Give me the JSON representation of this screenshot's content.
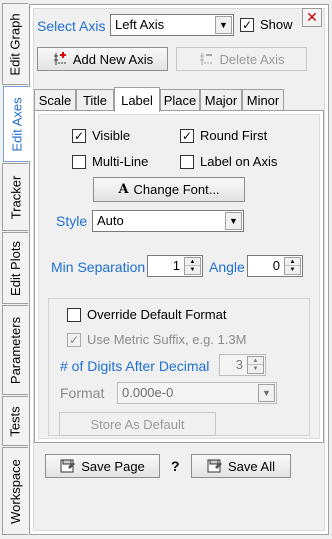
{
  "side_tabs": [
    "Edit Graph",
    "Edit Axes",
    "Tracker",
    "Edit Plots",
    "Parameters",
    "Tests",
    "Workspace"
  ],
  "top": {
    "select_axis_label": "Select Axis",
    "select_axis_value": "Left Axis",
    "show_label": "Show",
    "show_checked": true,
    "add_axis_label": "Add New Axis",
    "delete_axis_label": "Delete Axis"
  },
  "tabs": [
    "Scale",
    "Title",
    "Label",
    "Place",
    "Major",
    "Minor"
  ],
  "label_tab": {
    "visible_label": "Visible",
    "round_first_label": "Round First",
    "multi_line_label": "Multi-Line",
    "label_on_axis_label": "Label on Axis",
    "change_font_icon": "A",
    "change_font_label": "Change Font...",
    "style_label": "Style",
    "style_value": "Auto",
    "min_sep_label": "Min Separation",
    "min_sep_value": "1",
    "angle_label": "Angle",
    "angle_value": "0",
    "override_label": "Override Default Format",
    "metric_label": "Use Metric Suffix, e.g. 1.3M",
    "digits_label": "# of Digits After Decimal",
    "digits_value": "3",
    "format_label": "Format",
    "format_value": "0.000e-0",
    "store_default_label": "Store As Default"
  },
  "bottom": {
    "save_page_label": "Save Page",
    "help_label": "?",
    "save_all_label": "Save All"
  },
  "colors": {
    "accent": "#1e6fd0",
    "close": "#cc0000"
  }
}
